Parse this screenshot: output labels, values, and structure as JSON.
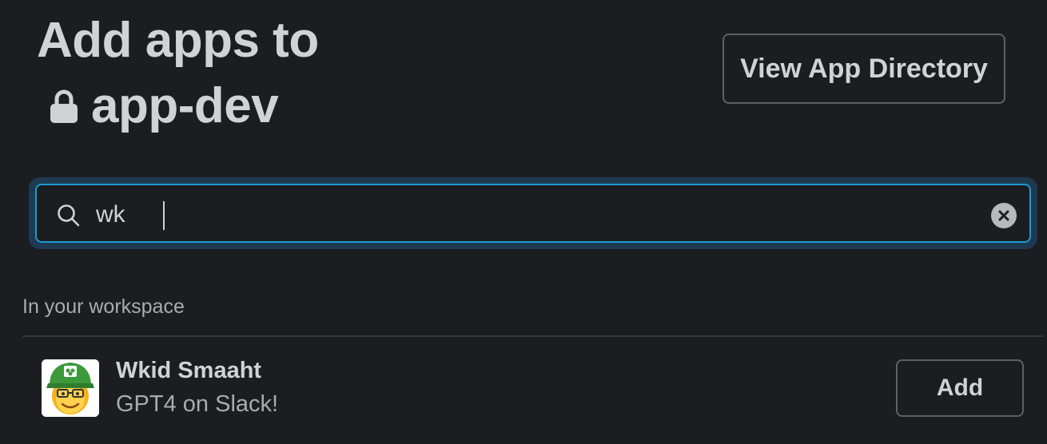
{
  "header": {
    "title_line1": "Add apps to",
    "channel_name": "app-dev",
    "channel_icon": "lock-icon",
    "directory_button_label": "View App Directory"
  },
  "search": {
    "value": "wk",
    "icon": "search-icon",
    "clear_icon": "close-circle-icon"
  },
  "results": {
    "section_label": "In your workspace",
    "apps": [
      {
        "name": "Wkid Smaaht",
        "description": "GPT4 on Slack!",
        "add_label": "Add",
        "avatar_icon": "bot-avatar"
      }
    ]
  },
  "colors": {
    "background": "#1b1d21",
    "focus_border": "#1d9bd1",
    "focus_glow": "#1e3a52",
    "text_primary": "#d1d2d3",
    "text_secondary": "#ababad"
  }
}
